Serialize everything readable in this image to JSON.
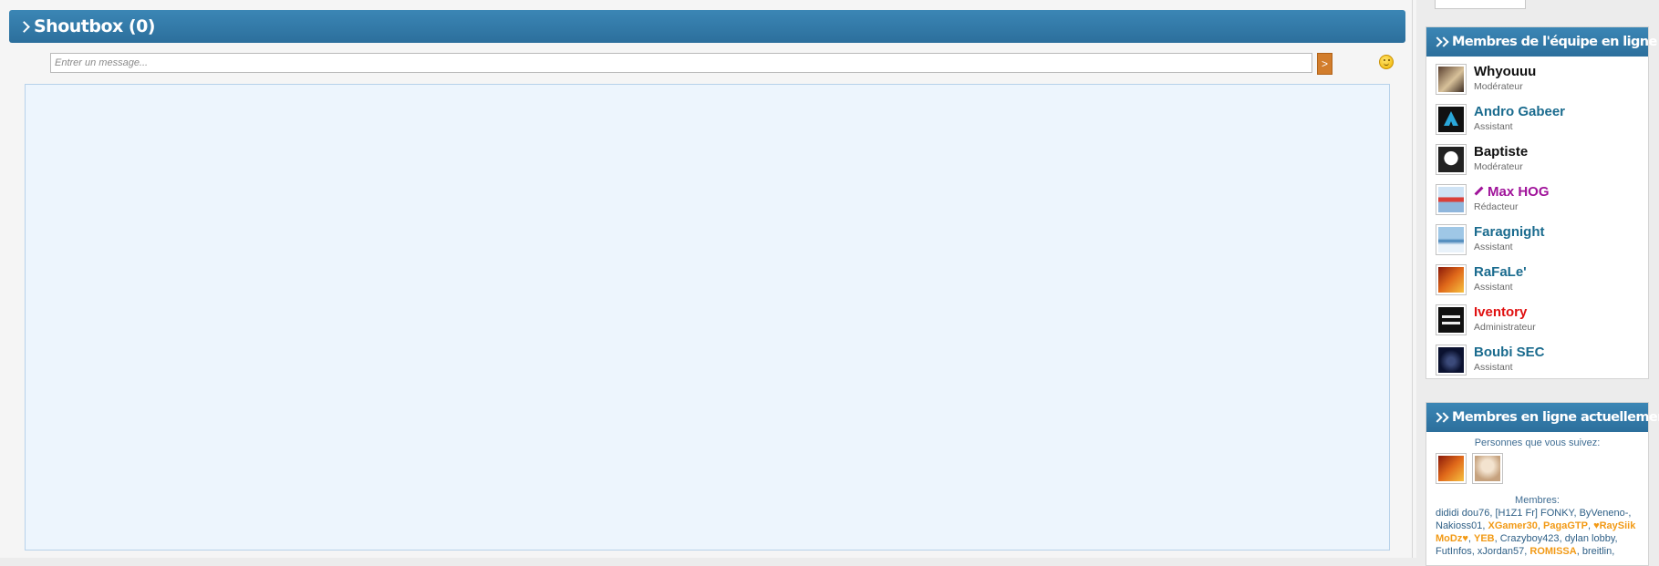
{
  "shoutbox": {
    "title": "Shoutbox (0)",
    "input_placeholder": "Entrer un message...",
    "send_label": ">"
  },
  "team_panel": {
    "title": "Membres de l'équipe en ligne",
    "members": [
      {
        "name": "Whyouuu",
        "role": "Modérateur",
        "color": "#111111"
      },
      {
        "name": "Andro Gabeer",
        "role": "Assistant",
        "color": "#1a6b8e"
      },
      {
        "name": "Baptiste",
        "role": "Modérateur",
        "color": "#111111"
      },
      {
        "name": "Max HOG",
        "role": "Rédacteur",
        "color": "#a0139a"
      },
      {
        "name": "Faragnight",
        "role": "Assistant",
        "color": "#1a6b8e"
      },
      {
        "name": "RaFaLe'",
        "role": "Assistant",
        "color": "#1a6b8e"
      },
      {
        "name": "Iventory",
        "role": "Administrateur",
        "color": "#e01010"
      },
      {
        "name": "Boubi SEC",
        "role": "Assistant",
        "color": "#1a6b8e"
      }
    ]
  },
  "online_panel": {
    "title": "Membres en ligne actuellement",
    "follow_label": "Personnes que vous suivez:",
    "members_label": "Membres:",
    "members": [
      {
        "name": "dididi dou76",
        "style": "normal"
      },
      {
        "name": "[H1Z1 Fr] FONKY",
        "style": "normal"
      },
      {
        "name": "ByVeneno-",
        "style": "normal"
      },
      {
        "name": "Nakioss01",
        "style": "normal"
      },
      {
        "name": "XGamer30",
        "style": "orange"
      },
      {
        "name": "PagaGTP",
        "style": "orange"
      },
      {
        "name": "♥RaySiik MoDz♥",
        "style": "orange"
      },
      {
        "name": "YEB",
        "style": "orange"
      },
      {
        "name": "Crazyboy423",
        "style": "normal"
      },
      {
        "name": "dylan lobby",
        "style": "normal"
      },
      {
        "name": "FutInfos",
        "style": "normal"
      },
      {
        "name": "xJordan57",
        "style": "normal"
      },
      {
        "name": "ROMISSA",
        "style": "orange"
      },
      {
        "name": "breitlin",
        "style": "normal"
      }
    ]
  }
}
